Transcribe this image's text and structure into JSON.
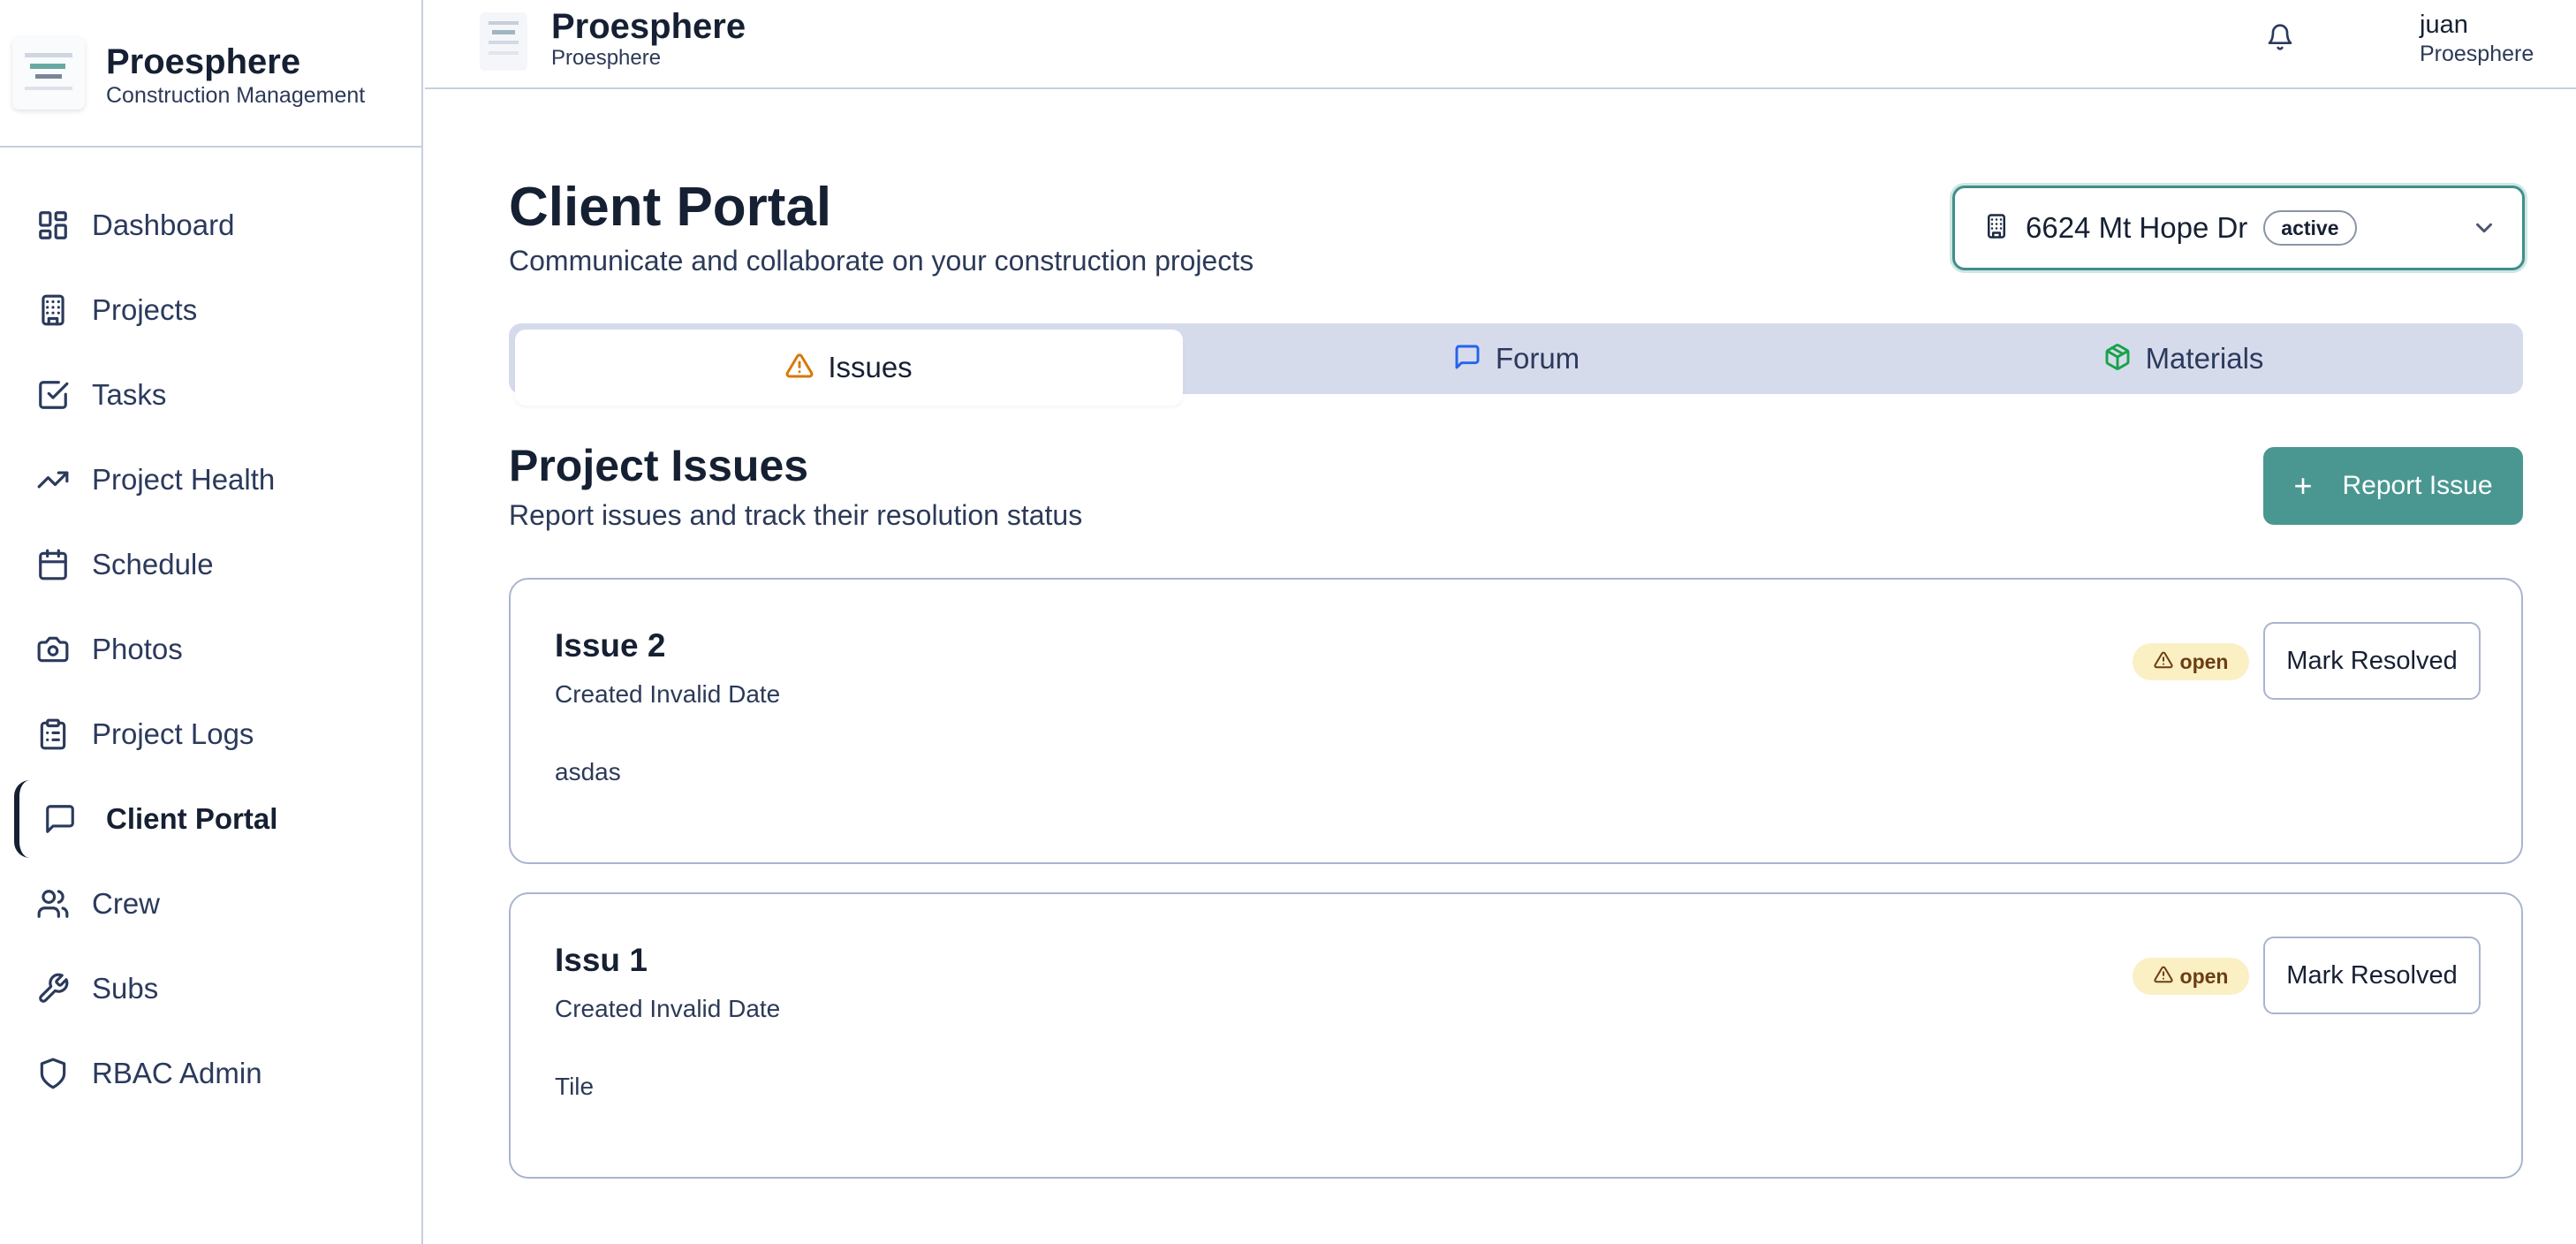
{
  "brand": {
    "name": "Proesphere",
    "subtitle": "Construction Management"
  },
  "sidebar": {
    "items": [
      {
        "label": "Dashboard",
        "icon": "dashboard-icon"
      },
      {
        "label": "Projects",
        "icon": "building-icon"
      },
      {
        "label": "Tasks",
        "icon": "check-square-icon"
      },
      {
        "label": "Project Health",
        "icon": "trending-up-icon"
      },
      {
        "label": "Schedule",
        "icon": "calendar-icon"
      },
      {
        "label": "Photos",
        "icon": "camera-icon"
      },
      {
        "label": "Project Logs",
        "icon": "clipboard-icon"
      },
      {
        "label": "Client Portal",
        "icon": "message-square-icon",
        "active": true
      },
      {
        "label": "Crew",
        "icon": "users-icon"
      },
      {
        "label": "Subs",
        "icon": "wrench-icon"
      },
      {
        "label": "RBAC Admin",
        "icon": "shield-icon"
      }
    ]
  },
  "header": {
    "title": "Proesphere",
    "subtitle": "Proesphere",
    "user": {
      "name": "juan",
      "org": "Proesphere"
    }
  },
  "page": {
    "title": "Client Portal",
    "subtitle": "Communicate and collaborate on your construction projects"
  },
  "project_select": {
    "value": "6624 Mt Hope Dr",
    "status": "active"
  },
  "tabs": [
    {
      "label": "Issues",
      "icon": "alert-triangle-icon",
      "color": "#d97706",
      "active": true
    },
    {
      "label": "Forum",
      "icon": "message-square-icon",
      "color": "#2563eb"
    },
    {
      "label": "Materials",
      "icon": "package-icon",
      "color": "#16a34a"
    }
  ],
  "issues_section": {
    "title": "Project Issues",
    "subtitle": "Report issues and track their resolution status",
    "report_button": "Report Issue"
  },
  "issues": [
    {
      "title": "Issue 2",
      "created": "Created Invalid Date",
      "description": "asdas",
      "status": "open",
      "action": "Mark Resolved"
    },
    {
      "title": "Issu 1",
      "created": "Created Invalid Date",
      "description": "Tile",
      "status": "open",
      "action": "Mark Resolved"
    }
  ],
  "colors": {
    "accent": "#4a9792",
    "status_open_bg": "#fbefc4",
    "status_open_text": "#6b3e12",
    "tab_bar_bg": "#d6dbec"
  }
}
